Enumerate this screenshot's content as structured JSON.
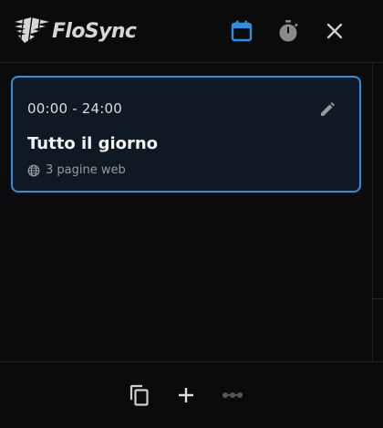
{
  "app": {
    "name": "FloSync"
  },
  "header": {
    "buttons": [
      {
        "icon": "calendar-icon",
        "active": true,
        "color": "#2e8fe0"
      },
      {
        "icon": "timer-icon",
        "active": false,
        "color": "#8a8a8a"
      },
      {
        "icon": "close-icon",
        "active": false,
        "color": "#cfcfcf"
      }
    ]
  },
  "schedule": {
    "items": [
      {
        "time_range": "00:00 - 24:00",
        "title": "Tutto il giorno",
        "meta": "3 pagine web",
        "meta_icon": "globe-icon",
        "selected": true
      }
    ]
  },
  "footer": {
    "buttons": [
      {
        "icon": "copy-icon",
        "enabled": true
      },
      {
        "icon": "add-icon",
        "enabled": true
      },
      {
        "icon": "more-icon",
        "enabled": false
      }
    ]
  },
  "colors": {
    "accent": "#2e8fe0",
    "background": "#0b0b0b",
    "card_background": "#0f1923"
  }
}
